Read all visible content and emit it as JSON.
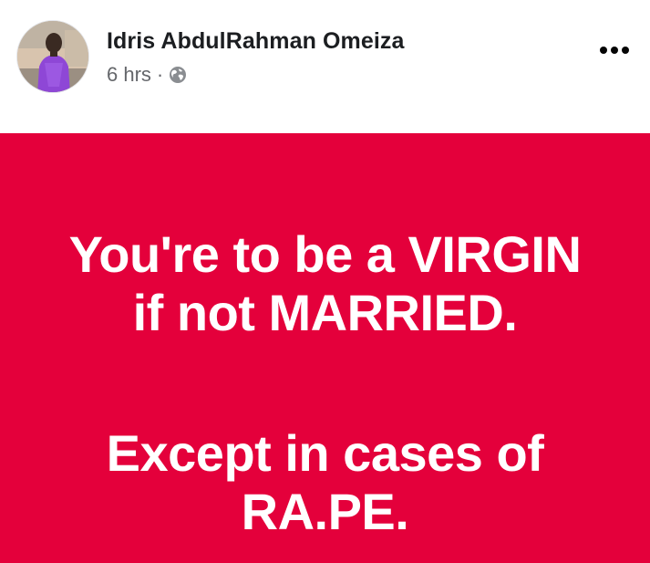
{
  "post": {
    "author": {
      "name": "Idris AbdulRahman Omeiza",
      "avatar_icon": "profile-photo"
    },
    "time": "6 hrs",
    "separator": "·",
    "audience_icon": "globe-icon",
    "more_icon": "more-options-icon",
    "body": {
      "background_color": "#e4003b",
      "text_color": "#ffffff",
      "paragraphs": [
        {
          "lines": [
            "You're to be a VIRGIN",
            "if not MARRIED."
          ]
        },
        {
          "lines": [
            "Except in cases of",
            "RA.PE."
          ]
        }
      ]
    }
  }
}
